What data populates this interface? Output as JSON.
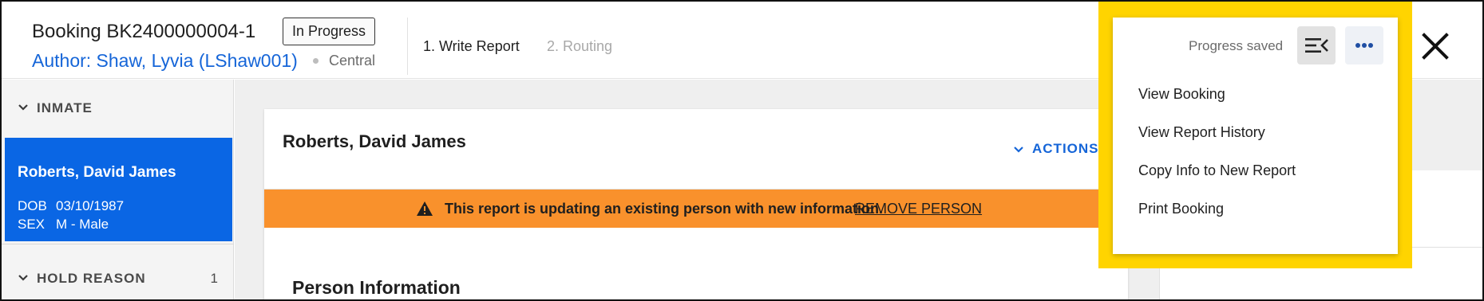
{
  "header": {
    "booking_title": "Booking BK2400000004-1",
    "status_badge": "In Progress",
    "author": "Author: Shaw, Lyvia (LShaw001)",
    "region": "Central",
    "steps": [
      "1. Write Report",
      "2. Routing"
    ]
  },
  "sidebar": {
    "sections": [
      {
        "label": "INMATE"
      },
      {
        "label": "HOLD REASON",
        "count": "1"
      }
    ],
    "inmate": {
      "name": "Roberts, David James",
      "dob_label": "DOB",
      "dob": "03/10/1987",
      "sex_label": "SEX",
      "sex": "M - Male"
    }
  },
  "main": {
    "person_name": "Roberts, David James",
    "actions_label": "ACTIONS",
    "banner": {
      "message": "This report is updating an existing person with new information.",
      "link": "REMOVE PERSON"
    },
    "section_title": "Person Information",
    "peek_text": "."
  },
  "menu": {
    "progress_saved": "Progress saved",
    "items": [
      "View Booking",
      "View Report History",
      "Copy Info to New Report",
      "Print Booking"
    ]
  },
  "colors": {
    "accent": "#1565d8",
    "selected_card": "#0a66e4",
    "warning_banner": "#f9912c",
    "highlight": "#ffd400"
  },
  "icons": [
    "close-icon",
    "chevron-down-icon",
    "warning-icon",
    "panel-collapse-icon",
    "more-horizontal-icon"
  ]
}
